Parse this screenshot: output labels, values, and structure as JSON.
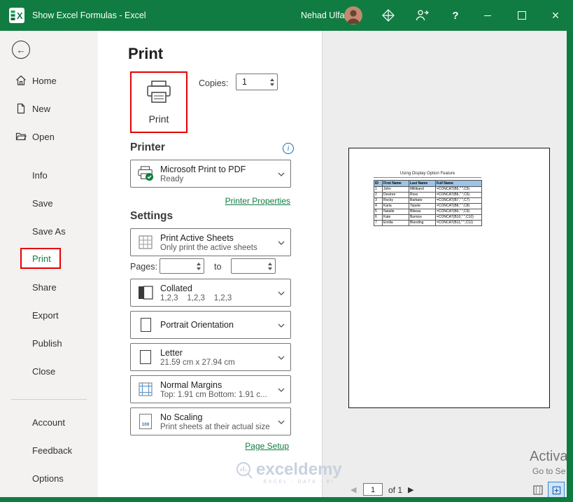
{
  "colors": {
    "titlebar_green": "#107C41",
    "annotation_red": "#E30000",
    "link_green": "#107C41",
    "table_header_blue": "#9DC3E6"
  },
  "title_bar": {
    "title": "Show Excel Formulas  -  Excel",
    "user_name": "Nehad Ulfat",
    "help_label": "?"
  },
  "sidebar": {
    "top": [
      "Home",
      "New",
      "Open"
    ],
    "middle": [
      "Info",
      "Save",
      "Save As",
      "Print",
      "Share",
      "Export",
      "Publish",
      "Close"
    ],
    "bottom": [
      "Account",
      "Feedback",
      "Options"
    ]
  },
  "print_page": {
    "heading": "Print",
    "print_button_label": "Print",
    "copies_label": "Copies:",
    "copies_value": "1",
    "printer_section": {
      "heading": "Printer",
      "printer_name": "Microsoft Print to PDF",
      "printer_status": "Ready",
      "properties_link": "Printer Properties"
    },
    "settings_section": {
      "heading": "Settings",
      "pages_label": "Pages:",
      "pages_from": "",
      "pages_to": "",
      "to_label": "to",
      "dropdowns": [
        {
          "title": "Print Active Sheets",
          "subtitle": "Only print the active sheets"
        },
        {
          "title": "Collated",
          "subtitle": "1,2,3    1,2,3    1,2,3"
        },
        {
          "title": "Portrait Orientation",
          "subtitle": ""
        },
        {
          "title": "Letter",
          "subtitle": "21.59 cm x 27.94 cm"
        },
        {
          "title": "Normal Margins",
          "subtitle": "Top: 1.91 cm Bottom: 1.91 c..."
        },
        {
          "title": "No Scaling",
          "subtitle": "Print sheets at their actual size"
        }
      ],
      "scaling_icon_label": "100",
      "page_setup_link": "Page Setup"
    }
  },
  "preview": {
    "document": {
      "table_title": "Using Display Option Feature",
      "columns": [
        "ID",
        "First Name",
        "Last Name",
        "Full Name"
      ],
      "rows": [
        [
          "1",
          "John",
          "Milliband",
          "=CONCAT(B5,\" \",C5)"
        ],
        [
          "2",
          "Desiree",
          "Ross",
          "=CONCAT(B6,\" \",C6)"
        ],
        [
          "3",
          "Rocky",
          "Barbato",
          "=CONCAT(B7,\" \",C7)"
        ],
        [
          "4",
          "Karla",
          "Topete",
          "=CONCAT(B8,\" \",C8)"
        ],
        [
          "5",
          "Natalie",
          "Bibeau",
          "=CONCAT(B9,\" \",C9)"
        ],
        [
          "6",
          "Kate",
          "Burnice",
          "=CONCAT(B10,\" \",C10)"
        ],
        [
          "7",
          "Emilia",
          "Blunding",
          "=CONCAT(B11,\" \",C11)"
        ]
      ]
    },
    "page_nav": {
      "current_page": "1",
      "of_label": "of 1"
    }
  },
  "watermarks": {
    "exceldemy": "exceldemy",
    "exceldemy_sub": "EXCEL - DATA - BI",
    "activate_line1": "Activa",
    "activate_line2": "Go to Se"
  }
}
